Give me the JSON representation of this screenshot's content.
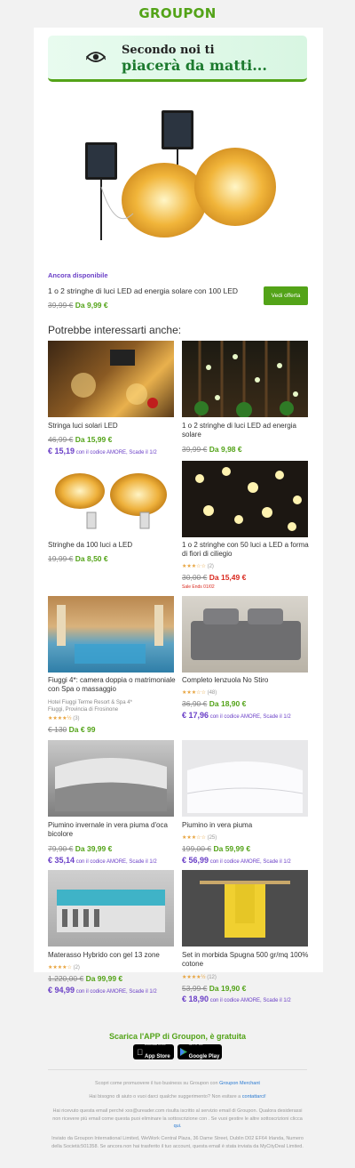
{
  "brand": {
    "logo_text": "GROUPON",
    "accent": "#53a318",
    "promo_purple": "#6a3fc7"
  },
  "hero": {
    "line1": "Secondo noi ti",
    "line2": "piacerà da matti...",
    "icon": "eye-icon"
  },
  "main_offer": {
    "badge": "Ancora disponibile",
    "title": "1 o 2 stringhe di luci LED ad energia solare con 100 LED",
    "old_price": "39,99 €",
    "new_price": "Da 9,99 €",
    "button_label": "Vedi offerta"
  },
  "section_title": "Potrebbe interessarti anche:",
  "products": [
    {
      "title": "Stringa luci solari LED",
      "old_price": "46,99 €",
      "new_price": "Da 15,99 €",
      "code_price": "€ 15,19",
      "code_text": "con il codice AMORE, Scade il 1/2"
    },
    {
      "title": "1 o 2 stringhe di luci LED ad energia solare",
      "old_price": "39,99 €",
      "new_price": "Da 9,98 €"
    },
    {
      "title": "Stringhe da 100 luci a LED",
      "old_price": "19,99 €",
      "new_price": "Da 8,50 €"
    },
    {
      "title": "1 o 2 stringhe con 50 luci a LED a forma di fiori di ciliegio",
      "stars": "★★★☆☆",
      "rating_count": "(2)",
      "old_price": "30,00 €",
      "new_price": "Da 15,49 €",
      "sale_ends": "Sale Ends 01/02"
    },
    {
      "title": "Fiuggi 4*: camera doppia o matrimoniale con Spa o massaggio",
      "hotel": "Hotel Fiuggi Terme Resort & Spa 4*",
      "location": "Fiuggi, Provincia di Frosinone",
      "stars": "★★★★½",
      "rating_count": "(3)",
      "old_price": "€ 130",
      "new_price": "Da € 99"
    },
    {
      "title": "Completo lenzuola No Stiro",
      "stars": "★★★☆☆",
      "rating_count": "(48)",
      "old_price": "36,90 €",
      "new_price": "Da 18,90 €",
      "code_price": "€ 17,96",
      "code_text": "con il codice AMORE, Scade il 1/2"
    },
    {
      "title": "Piumino invernale in vera piuma d'oca bicolore",
      "old_price": "79,90 €",
      "new_price": "Da 39,99 €",
      "code_price": "€ 35,14",
      "code_text": "con il codice AMORE, Scade il 1/2"
    },
    {
      "title": "Piumino in vera piuma",
      "stars": "★★★☆☆",
      "rating_count": "(25)",
      "old_price": "199,00 €",
      "new_price": "Da 59,99 €",
      "code_price": "€ 56,99",
      "code_text": "con il codice AMORE, Scade il 1/2"
    },
    {
      "title": "Materasso Hybrido con gel 13 zone",
      "stars": "★★★★☆",
      "rating_count": "(2)",
      "old_price": "1.220,00 €",
      "new_price": "Da 99,99 €",
      "code_price": "€ 94,99",
      "code_text": "con il codice AMORE, Scade il 1/2"
    },
    {
      "title": "Set in morbida Spugna 500 gr/mq 100% cotone",
      "stars": "★★★★½",
      "rating_count": "(12)",
      "old_price": "53,99 €",
      "new_price": "Da 19,90 €",
      "code_price": "€ 18,90",
      "code_text": "con il codice AMORE, Scade il 1/2"
    }
  ],
  "app": {
    "title": "Scarica l'APP di Groupon, è gratuita",
    "appstore_small": "Download on the",
    "appstore_label": "App Store",
    "googleplay_small": "GET IT ON",
    "googleplay_label": "Google Play"
  },
  "footer": {
    "merchant_text": "Scopri come promuovere il tuo business su Groupon con",
    "merchant_link": "Groupon Merchant",
    "help_text": "Hai bisogno di aiuto o vuoi darci qualche suggerimento? Non esitare a",
    "help_link": "contattarci!",
    "unsubscribe_text": "Hai ricevuto questa email perché xxx@ureader.com risulta iscritto al servizio email di Groupon. Qualora desiderassi non ricevere più email come questa puoi eliminare la sottoscrizione con . Se vuoi gestire le altre sottoscrizioni clicca",
    "unsubscribe_link": "qui.",
    "legal_text": "Inviato da Groupon International Limited, WeWork Central Plaza, 36 Dame Street, Dublin D02 EF64 Irlanda, Numero della Società:501358. Se ancora non hai trasferito il tuo account, questa email è stata inviata da MyCityDeal Limited."
  }
}
